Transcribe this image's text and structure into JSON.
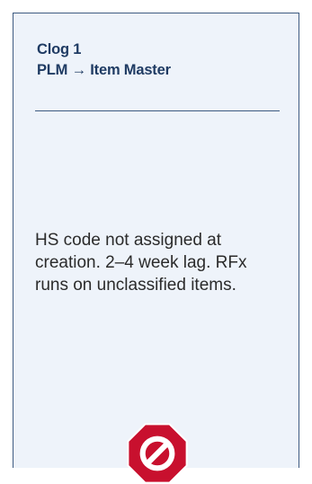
{
  "card": {
    "title": "Clog 1",
    "subtitle": "PLM → Item Master",
    "description": "HS code not assigned at creation. 2–4 week lag. RFx runs on unclassified items."
  },
  "icon": {
    "name": "stop-prohibited-icon",
    "fill_color": "#c8102e",
    "border_color": "#ffffff"
  },
  "colors": {
    "card_background": "#eef3fa",
    "card_border": "#3d5a80",
    "title_text": "#1f3b63"
  }
}
